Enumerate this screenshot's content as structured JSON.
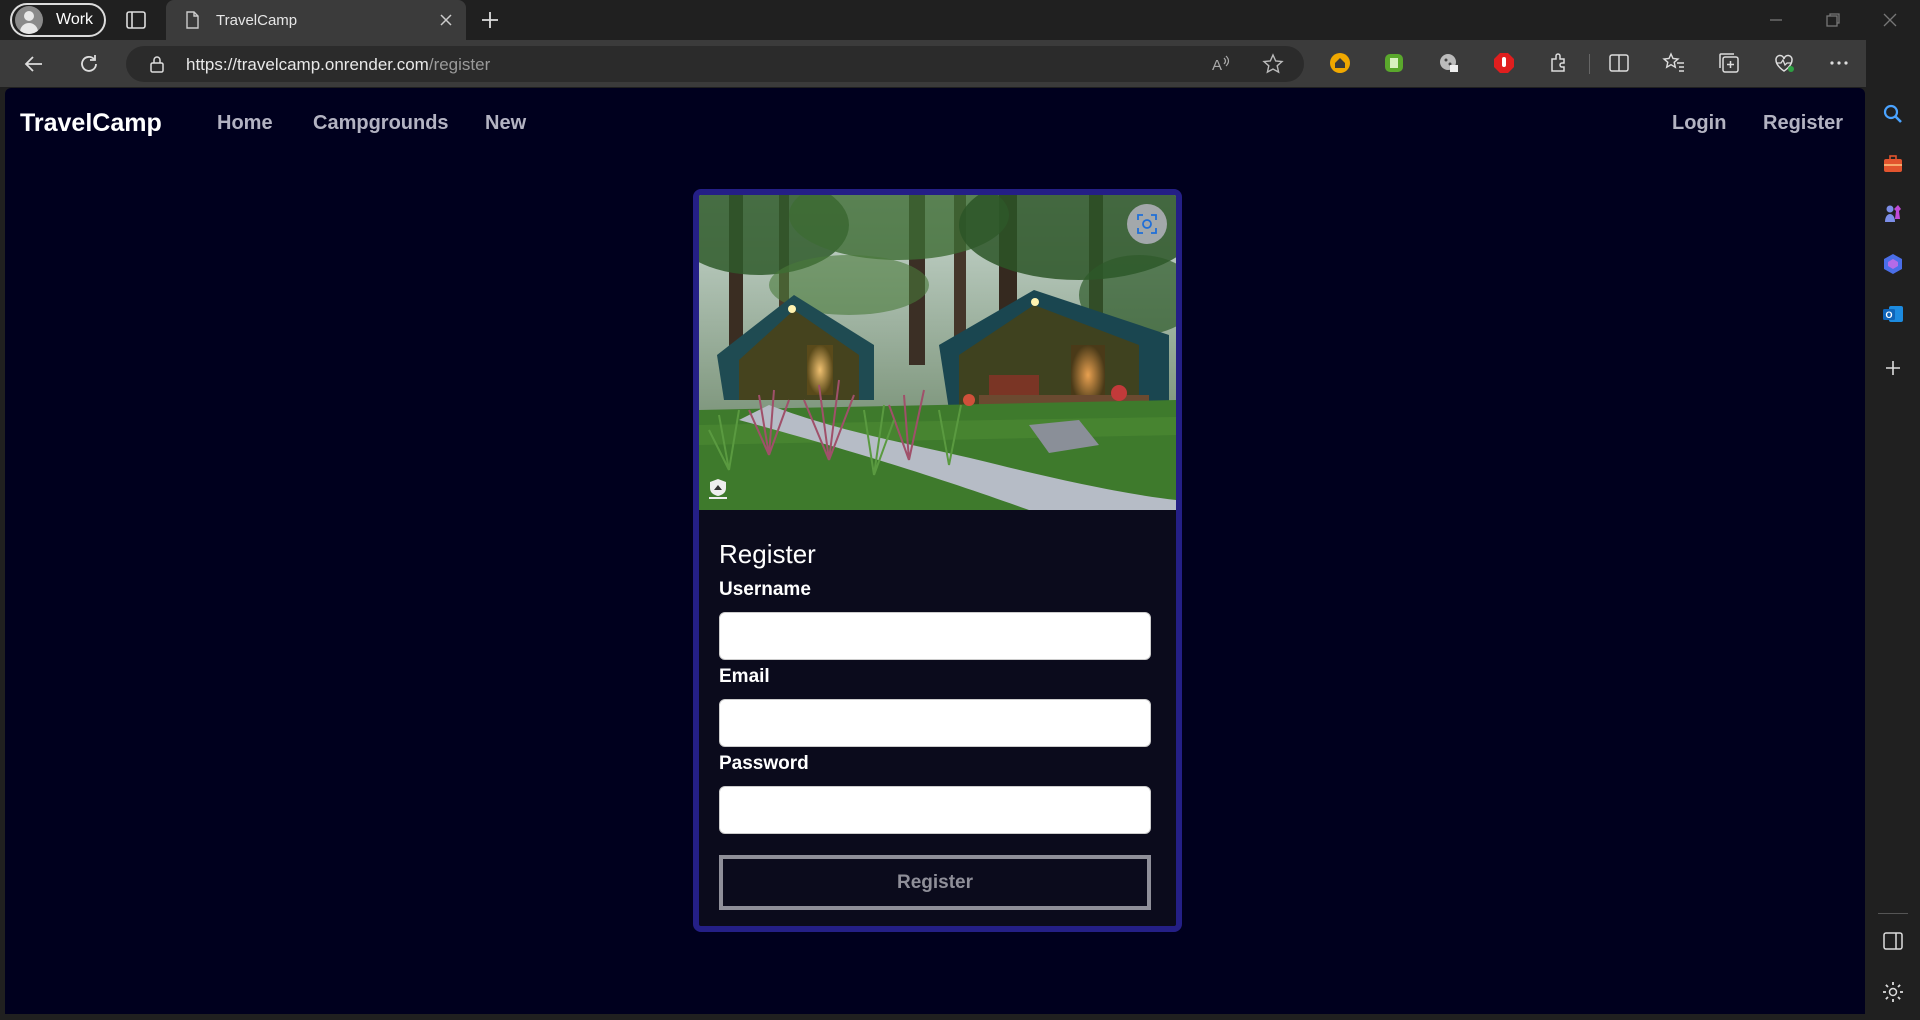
{
  "browser": {
    "profile_label": "Work",
    "tab_title": "TravelCamp",
    "url_host": "https://travelcamp.onrender.com",
    "url_path": "/register"
  },
  "site": {
    "brand": "TravelCamp",
    "nav_left": [
      "Home",
      "Campgrounds",
      "New"
    ],
    "nav_right": [
      "Login",
      "Register"
    ]
  },
  "register_form": {
    "heading": "Register",
    "username_label": "Username",
    "username_value": "",
    "email_label": "Email",
    "email_value": "",
    "password_label": "Password",
    "password_value": "",
    "submit_label": "Register"
  },
  "colors": {
    "page_bg": "#00001e",
    "card_border": "#241f86",
    "card_bg": "#0b0b1c"
  }
}
